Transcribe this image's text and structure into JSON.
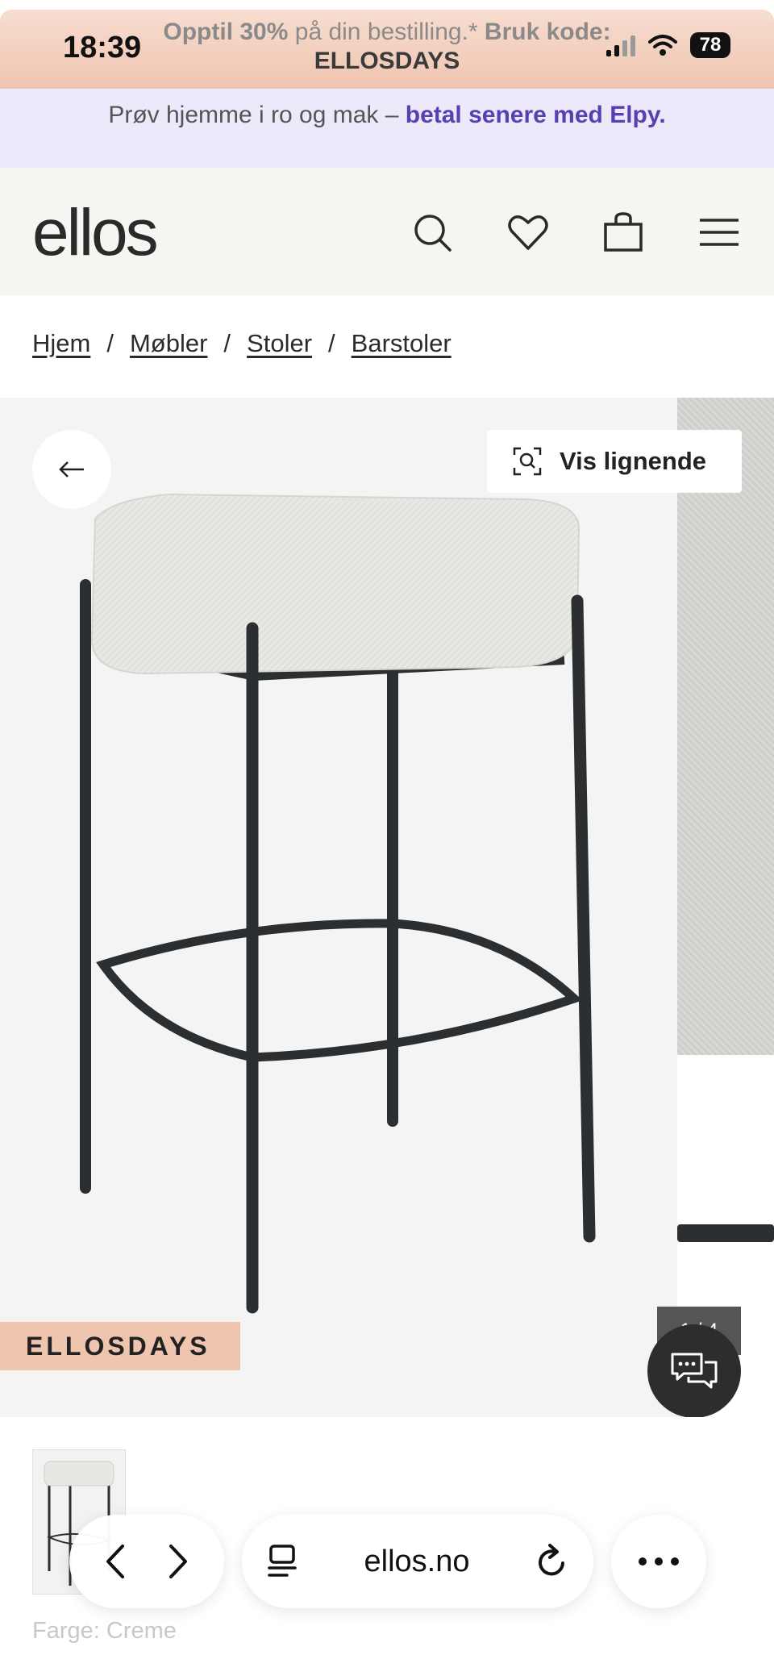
{
  "status_bar": {
    "time": "18:39",
    "battery": "78"
  },
  "promo": {
    "bold_prefix": "Opptil 30%",
    "text": " på din bestilling.*",
    "bold_suffix": " Bruk kode:",
    "code": "ELLOSDAYS"
  },
  "info_strip": {
    "text": "Prøv hjemme i ro og mak – ",
    "link": "betal senere med Elpy."
  },
  "header": {
    "logo": "ellos",
    "icons": [
      "search-icon",
      "heart-icon",
      "shopping-bag-icon",
      "menu-icon"
    ]
  },
  "breadcrumb": {
    "items": [
      "Hjem",
      "Møbler",
      "Stoler",
      "Barstoler"
    ],
    "separator": "/"
  },
  "gallery": {
    "similar_button": "Vis lignende",
    "badge": "ELLOSDAYS",
    "counter": "1 / 4"
  },
  "product": {
    "color_label": "Farge: Creme"
  },
  "browser": {
    "url": "ellos.no"
  },
  "colors": {
    "promo_bg": "#efc5b0",
    "info_bg": "#ece9fb",
    "link_purple": "#5a3fb0",
    "header_bg": "#f6f5f1",
    "stool_frame": "#2c2f31",
    "cushion": "#e8e7e3"
  }
}
